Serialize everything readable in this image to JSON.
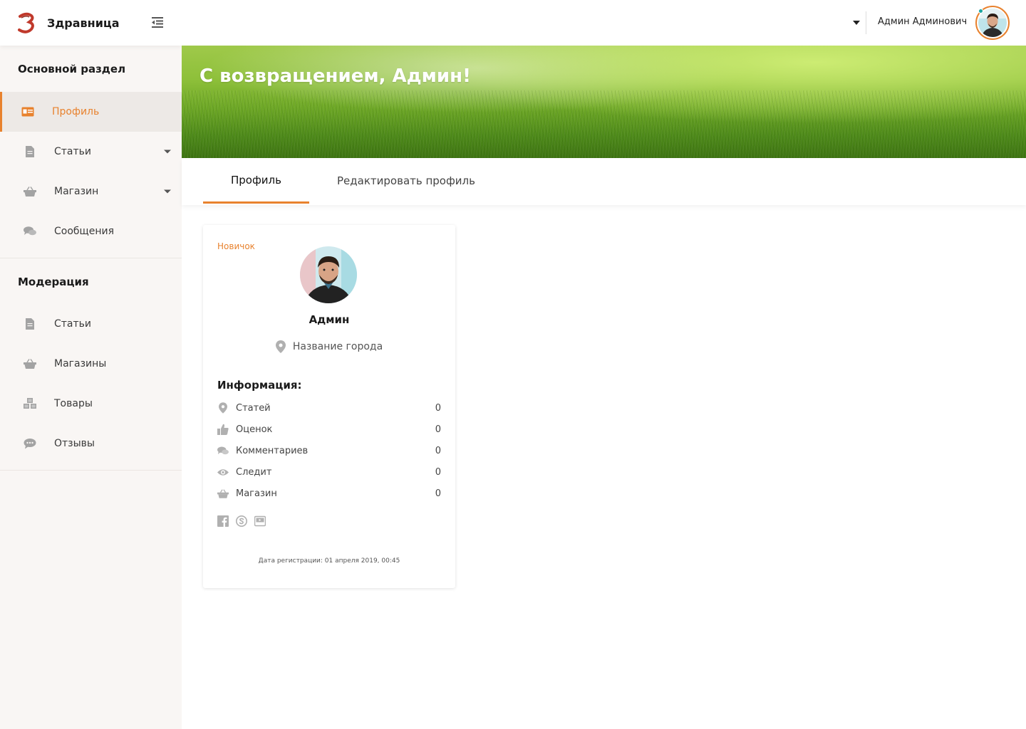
{
  "brand": {
    "name": "Здравница",
    "logo_letter": "З"
  },
  "sidebar": {
    "main_section_title": "Основной раздел",
    "main_items": [
      {
        "label": "Профиль",
        "icon": "id-card-icon",
        "active": true
      },
      {
        "label": "Статьи",
        "icon": "file-icon",
        "has_dropdown": true
      },
      {
        "label": "Магазин",
        "icon": "basket-icon",
        "has_dropdown": true
      },
      {
        "label": "Сообщения",
        "icon": "comments-icon"
      }
    ],
    "moderation_title": "Модерация",
    "moderation_items": [
      {
        "label": "Статьи",
        "icon": "file-icon"
      },
      {
        "label": "Магазины",
        "icon": "basket-icon"
      },
      {
        "label": "Товары",
        "icon": "cubes-icon"
      },
      {
        "label": "Отзывы",
        "icon": "comment-dots-icon"
      }
    ]
  },
  "topbar": {
    "user_name": "Админ Админович"
  },
  "banner": {
    "title": "С возвращением, Админ!"
  },
  "tabs": [
    {
      "label": "Профиль",
      "active": true
    },
    {
      "label": "Редактировать профиль",
      "active": false
    }
  ],
  "profile": {
    "rank": "Новичок",
    "name": "Админ",
    "city": "Название города",
    "info_title": "Информация:",
    "stats": [
      {
        "label": "Статей",
        "value": "0",
        "icon": "map-marker-icon"
      },
      {
        "label": "Оценок",
        "value": "0",
        "icon": "thumbs-up-icon"
      },
      {
        "label": "Комментариев",
        "value": "0",
        "icon": "comments-icon"
      },
      {
        "label": "Следит",
        "value": "0",
        "icon": "eye-icon"
      },
      {
        "label": "Магазин",
        "value": "0",
        "icon": "basket-icon"
      }
    ],
    "socials": [
      "facebook-icon",
      "skype-icon",
      "youtube-icon"
    ],
    "registration": "Дата регистрации: 01 апреля 2019, 00:45"
  },
  "colors": {
    "accent": "#e8822e",
    "sidebar_bg": "#f9f6f4",
    "status": "#1aa5a0"
  }
}
